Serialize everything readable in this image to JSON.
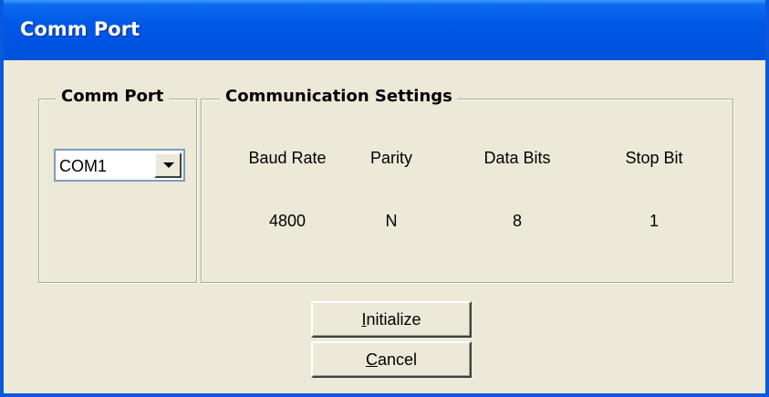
{
  "window": {
    "title": "Comm Port"
  },
  "comm_port_group": {
    "legend": "Comm Port",
    "select": {
      "selected": "COM1"
    }
  },
  "settings_group": {
    "legend": "Communication Settings",
    "columns": [
      {
        "label": "Baud Rate",
        "value": "4800"
      },
      {
        "label": "Parity",
        "value": "N"
      },
      {
        "label": "Data Bits",
        "value": "8"
      },
      {
        "label": "Stop Bit",
        "value": "1"
      }
    ]
  },
  "buttons": {
    "initialize": {
      "mnemonic": "I",
      "rest": "nitialize"
    },
    "cancel": {
      "mnemonic": "C",
      "rest": "ancel"
    }
  },
  "colors": {
    "title_bar": "#0054e3",
    "window_bg": "#ece9d8",
    "frame_border": "#0a59dc",
    "groupbox_border": "#a9a79a"
  },
  "icons": {
    "combo_arrow": "chevron-down-icon"
  }
}
